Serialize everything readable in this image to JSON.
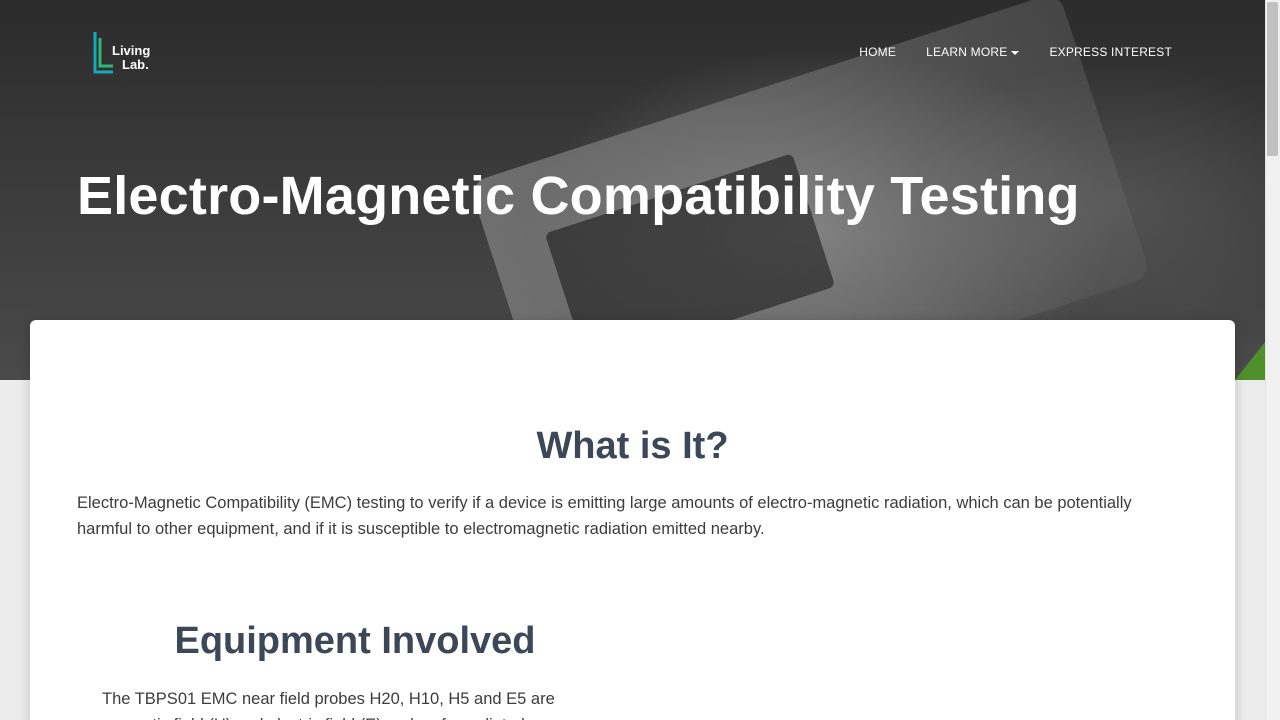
{
  "logo": {
    "line1": "Living",
    "line2": "Lab."
  },
  "nav": {
    "items": [
      {
        "label": "HOME"
      },
      {
        "label": "LEARN MORE",
        "has_dropdown": true
      },
      {
        "label": "EXPRESS INTEREST"
      }
    ]
  },
  "hero": {
    "title": "Electro-Magnetic Compatibility Testing"
  },
  "main": {
    "what_title": "What is It?",
    "what_text": "Electro-Magnetic Compatibility (EMC) testing to verify if a device is emitting large amounts of electro-magnetic radiation, which can be potentially harmful to other equipment, and if it is susceptible to electromagnetic radiation emitted nearby.",
    "equipment_title": "Equipment Involved",
    "equipment_text": "The TBPS01 EMC near field probes H20, H10, H5 and E5 are magnetic field (H) and electric field (E) probes for radiated"
  },
  "colors": {
    "accent_green": "#4f8f2c",
    "logo_green": "#2eb872",
    "logo_teal": "#17a9b8",
    "heading": "#3c4858"
  },
  "icons": {
    "logo": "living-lab-logo-icon",
    "dropdown": "caret-down-icon"
  }
}
